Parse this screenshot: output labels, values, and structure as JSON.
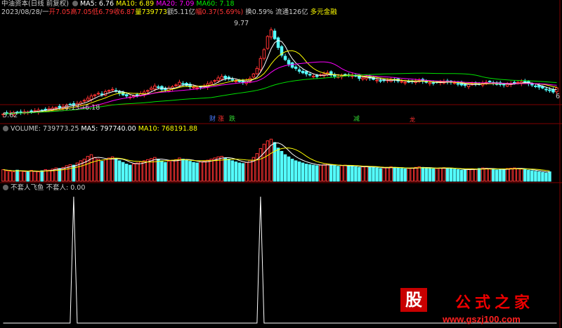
{
  "header": {
    "title": "中油资本(日线 前复权)",
    "ma5": "MA5: 6.76",
    "ma10": "MA10: 6.89",
    "ma20": "MA20: 7.09",
    "ma60": "MA60: 7.18"
  },
  "quote": {
    "date": "2023/08/28/一",
    "open": "开7.05",
    "high": "高7.05",
    "low": "低6.79",
    "close": "收6.87",
    "volume": "量739773",
    "amount": "额5.11亿",
    "change": "幅0.37(5.69%)",
    "turnover": "换0.59%",
    "float": "流通126亿",
    "margin": "多元金融"
  },
  "price_labels": {
    "high_mark": "9.77",
    "low_mark": "5.62",
    "mid_mark": "6.13→6.18",
    "right_mark": "6"
  },
  "event_tags": [
    {
      "text": "财",
      "color": "#4a7cff"
    },
    {
      "text": "涨",
      "color": "#ff3030"
    },
    {
      "text": "跌",
      "color": "#30d030"
    },
    {
      "text": "减",
      "color": "#30d030"
    },
    {
      "text": "龙",
      "color": "#ff3030"
    }
  ],
  "volume_header": {
    "volume": "VOLUME: 739773.25",
    "ma5": "MA5: 797740.00",
    "ma10": "MA10: 768191.88"
  },
  "indicator_header": {
    "name": "不套人飞鱼",
    "value": "不套人: 0.00"
  },
  "watermark": {
    "logo": "股",
    "brand": "公式之家",
    "site": "www.gszj100.com"
  },
  "colors": {
    "up": "#ff3232",
    "down": "#54fcfc",
    "ma5": "#ffffff",
    "ma10": "#ffff00",
    "ma20": "#ff00ff",
    "ma60": "#00e000",
    "grid": "#800000"
  },
  "chart_data": {
    "type": "candlestick",
    "price_high": 9.77,
    "price_low": 5.62,
    "closes": [
      5.68,
      5.7,
      5.72,
      5.74,
      5.73,
      5.76,
      5.78,
      5.77,
      5.8,
      5.83,
      5.86,
      5.84,
      5.88,
      5.92,
      5.95,
      5.98,
      5.97,
      6.02,
      6.08,
      6.12,
      6.1,
      6.16,
      6.22,
      6.3,
      6.4,
      6.5,
      6.55,
      6.62,
      6.58,
      6.7,
      6.75,
      6.8,
      6.72,
      6.62,
      6.55,
      6.5,
      6.45,
      6.5,
      6.55,
      6.6,
      6.68,
      6.75,
      6.86,
      6.95,
      6.88,
      6.8,
      6.78,
      6.85,
      6.92,
      7.0,
      7.12,
      7.05,
      6.98,
      6.92,
      6.9,
      6.88,
      6.9,
      6.95,
      7.05,
      7.12,
      7.2,
      7.32,
      7.38,
      7.3,
      7.28,
      7.22,
      7.18,
      7.15,
      7.12,
      7.18,
      7.3,
      7.5,
      7.75,
      8.2,
      8.6,
      9.2,
      9.5,
      9.1,
      8.7,
      8.35,
      8.15,
      7.95,
      7.8,
      7.75,
      7.62,
      7.55,
      7.5,
      7.45,
      7.4,
      7.38,
      7.46,
      7.5,
      7.55,
      7.45,
      7.4,
      7.38,
      7.42,
      7.46,
      7.45,
      7.42,
      7.4,
      7.3,
      7.32,
      7.34,
      7.31,
      7.25,
      7.22,
      7.18,
      7.2,
      7.22,
      7.24,
      7.22,
      7.18,
      7.16,
      7.12,
      7.14,
      7.16,
      7.18,
      7.2,
      7.17,
      7.12,
      7.1,
      7.08,
      7.12,
      7.14,
      7.15,
      7.13,
      7.12,
      7.1,
      7.06,
      7.0,
      6.98,
      7.02,
      7.04,
      7.06,
      7.05,
      7.08,
      7.12,
      7.14,
      7.1,
      7.05,
      7.02,
      7.0,
      7.03,
      7.06,
      7.1,
      7.12,
      7.15,
      7.1,
      7.06,
      7.0,
      6.94,
      6.9,
      6.86,
      6.8,
      6.74,
      6.68,
      6.87
    ],
    "volumes": [
      42,
      38,
      36,
      34,
      40,
      37,
      35,
      33,
      39,
      36,
      34,
      38,
      42,
      40,
      44,
      48,
      46,
      50,
      56,
      60,
      58,
      66,
      74,
      80,
      90,
      96,
      86,
      80,
      72,
      78,
      84,
      88,
      82,
      74,
      68,
      62,
      58,
      62,
      66,
      70,
      74,
      78,
      82,
      86,
      80,
      74,
      68,
      72,
      76,
      78,
      84,
      80,
      76,
      72,
      68,
      66,
      70,
      72,
      76,
      80,
      84,
      88,
      90,
      84,
      80,
      74,
      70,
      66,
      64,
      68,
      76,
      86,
      100,
      118,
      134,
      146,
      152,
      140,
      120,
      108,
      96,
      88,
      80,
      74,
      70,
      66,
      62,
      60,
      58,
      56,
      58,
      60,
      62,
      58,
      56,
      54,
      56,
      58,
      56,
      54,
      52,
      50,
      52,
      54,
      52,
      50,
      48,
      46,
      48,
      50,
      52,
      50,
      48,
      46,
      45,
      46,
      48,
      50,
      52,
      50,
      48,
      46,
      45,
      46,
      48,
      49,
      48,
      46,
      44,
      42,
      40,
      41,
      43,
      45,
      44,
      46,
      48,
      47,
      45,
      43,
      41,
      42,
      44,
      46,
      47,
      48,
      46,
      44,
      42,
      40,
      38,
      36,
      34,
      32,
      30,
      34
    ],
    "indicator_peaks": [
      {
        "index": 20,
        "value": 1
      },
      {
        "index": 73,
        "value": 1
      }
    ]
  }
}
